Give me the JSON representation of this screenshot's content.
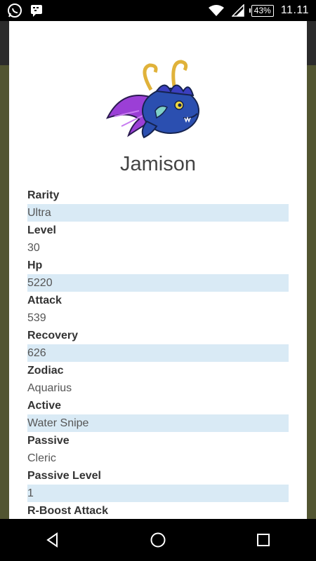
{
  "status_bar": {
    "left_icons": [
      "whatsapp-icon",
      "bbm-icon"
    ],
    "battery_percent": "43%",
    "time": "11.11"
  },
  "character": {
    "name": "Jamison",
    "avatar_icon": "blue-dragon-fish-icon"
  },
  "attributes": [
    {
      "label": "Rarity",
      "value": "Ultra"
    },
    {
      "label": "Level",
      "value": "30"
    },
    {
      "label": "Hp",
      "value": "5220"
    },
    {
      "label": "Attack",
      "value": "539"
    },
    {
      "label": "Recovery",
      "value": "626"
    },
    {
      "label": "Zodiac",
      "value": "Aquarius"
    },
    {
      "label": "Active",
      "value": "Water Snipe"
    },
    {
      "label": "Passive",
      "value": "Cleric"
    },
    {
      "label": "Passive Level",
      "value": "1"
    },
    {
      "label": "R-Boost Attack",
      "value": ""
    }
  ],
  "nav_bar": {
    "icons": [
      "back-icon",
      "home-icon",
      "recents-icon"
    ]
  },
  "colors": {
    "value_highlight": "#d9eaf5",
    "olive_background": "#525531"
  }
}
